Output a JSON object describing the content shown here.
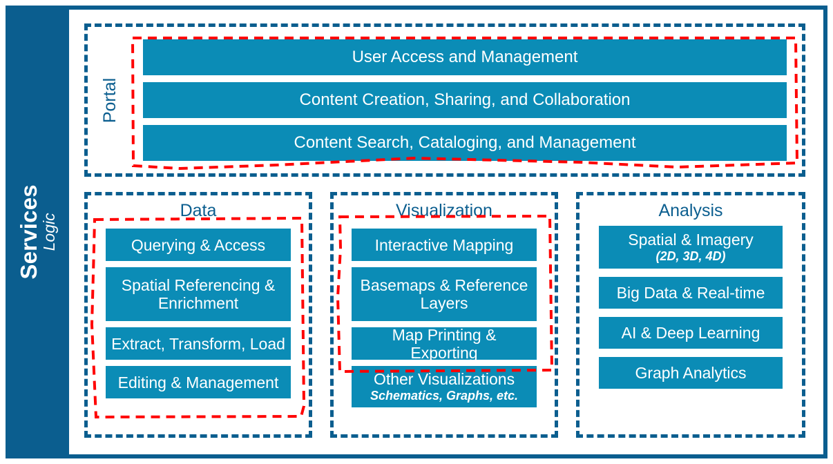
{
  "diagram": {
    "rail": {
      "title": "Services",
      "subtitle": "Logic"
    },
    "colors": {
      "rail_blue": "#0b5e8f",
      "group_border_blue": "#0b5e8f",
      "chip_blue": "#0b8cb6",
      "highlight_red": "#ff0000",
      "background": "#ffffff",
      "chip_text": "#ffffff",
      "title_text": "#0b5e8f"
    },
    "portal": {
      "label": "Portal",
      "items": [
        {
          "main": "User Access and Management",
          "sub": ""
        },
        {
          "main": "Content Creation, Sharing, and Collaboration",
          "sub": ""
        },
        {
          "main": "Content Search, Cataloging, and Management",
          "sub": ""
        }
      ]
    },
    "columns": [
      {
        "id": "data",
        "title": "Data",
        "items": [
          {
            "main": "Querying & Access",
            "sub": ""
          },
          {
            "main": "Spatial Referencing & Enrichment",
            "sub": ""
          },
          {
            "main": "Extract, Transform, Load",
            "sub": ""
          },
          {
            "main": "Editing & Management",
            "sub": ""
          }
        ]
      },
      {
        "id": "visualization",
        "title": "Visualization",
        "items": [
          {
            "main": "Interactive Mapping",
            "sub": ""
          },
          {
            "main": "Basemaps & Reference Layers",
            "sub": ""
          },
          {
            "main": "Map Printing & Exporting",
            "sub": ""
          },
          {
            "main": "Other Visualizations",
            "sub": "Schematics, Graphs, etc."
          }
        ]
      },
      {
        "id": "analysis",
        "title": "Analysis",
        "items": [
          {
            "main": "Spatial & Imagery",
            "sub": "(2D, 3D, 4D)"
          },
          {
            "main": "Big Data & Real-time",
            "sub": ""
          },
          {
            "main": "AI & Deep Learning",
            "sub": ""
          },
          {
            "main": "Graph Analytics",
            "sub": ""
          }
        ]
      }
    ]
  }
}
